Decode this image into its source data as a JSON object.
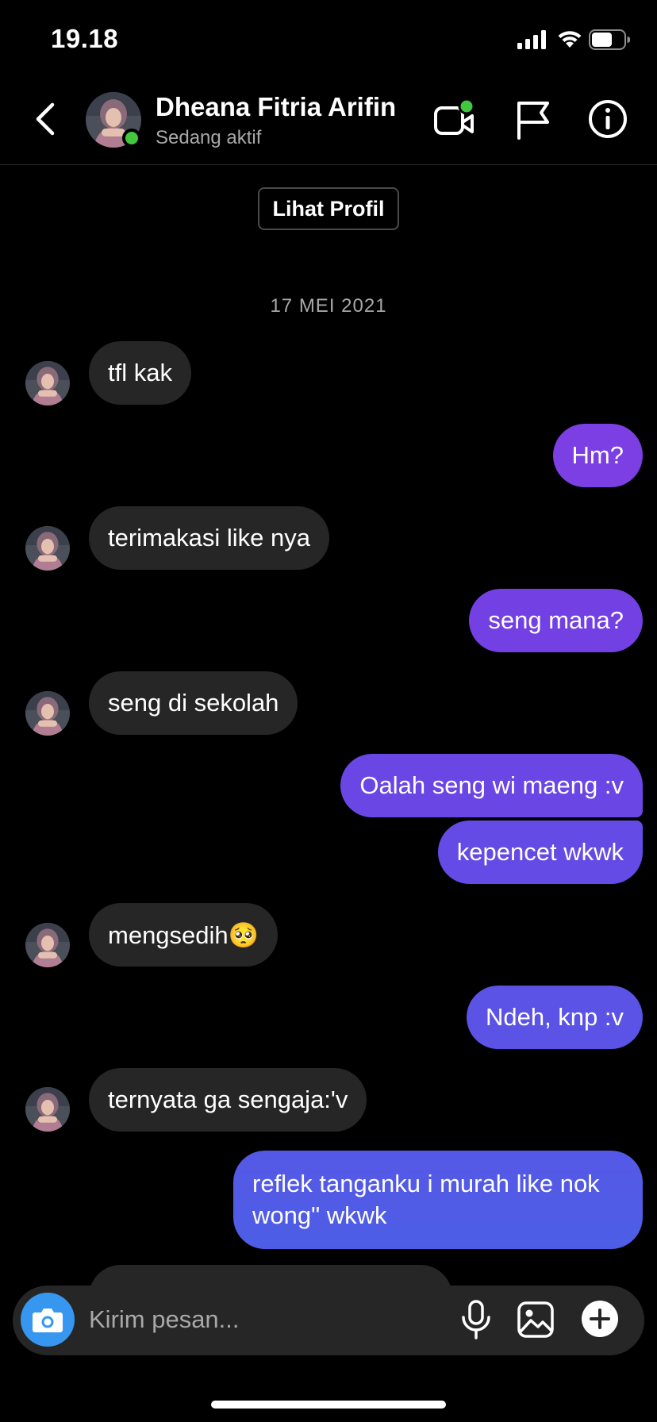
{
  "status_bar": {
    "time": "19.18"
  },
  "header": {
    "name": "Dheana Fitria Arifin",
    "status": "Sedang aktif",
    "icons": [
      "back-icon",
      "video-call-icon",
      "flag-icon",
      "info-icon"
    ]
  },
  "profile_button": "Lihat Profil",
  "date_divider": "17 MEI 2021",
  "messages": [
    {
      "from": "them",
      "text": "tfl kak"
    },
    {
      "from": "me",
      "text": "Hm?"
    },
    {
      "from": "them",
      "text": "terimakasi like nya"
    },
    {
      "from": "me",
      "text": "seng mana?"
    },
    {
      "from": "them",
      "text": "seng di sekolah"
    },
    {
      "from": "me",
      "text": "Oalah seng wi maeng :v"
    },
    {
      "from": "me",
      "text": "kepencet wkwk"
    },
    {
      "from": "them",
      "text": "mengsedih🥺"
    },
    {
      "from": "me",
      "text": "Ndeh, knp :v"
    },
    {
      "from": "them",
      "text": "ternyata ga sengaja:'v"
    },
    {
      "from": "me",
      "text": "reflek tanganku i murah like nok wong\" wkwk"
    }
  ],
  "composer": {
    "placeholder": "Kirim pesan...",
    "icons": [
      "camera-icon",
      "microphone-icon",
      "gallery-icon",
      "plus-icon"
    ]
  },
  "colors": {
    "background": "#000000",
    "incoming_bubble": "#262626",
    "outgoing_gradient": [
      "#7b3fe4",
      "#4f5ce6"
    ],
    "online": "#41c83c",
    "camera_button": "#3797f0"
  }
}
